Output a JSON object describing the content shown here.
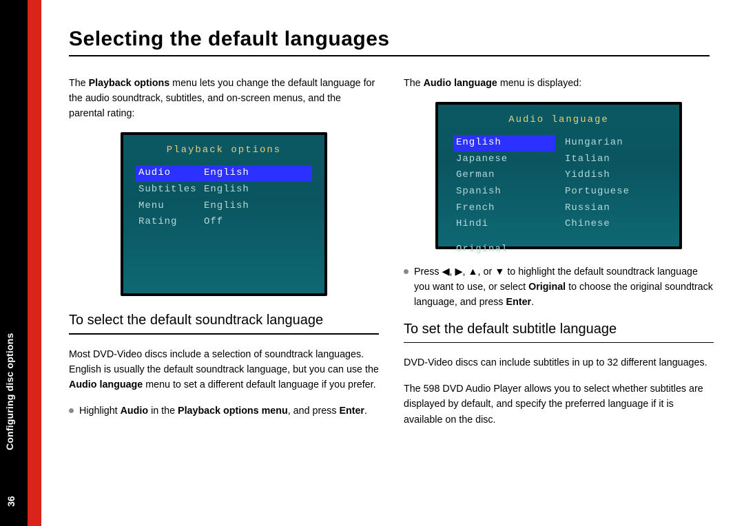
{
  "spine": {
    "section": "Configuring disc options",
    "page_number": "36"
  },
  "title": "Selecting the default languages",
  "left": {
    "intro_pre": "The ",
    "intro_bold": "Playback options",
    "intro_post": " menu lets you change the default language for the audio soundtrack, subtitles, and on-screen menus, and the parental rating:",
    "osd_title": "Playback options",
    "osd_rows": [
      {
        "k": "Audio",
        "v": "English",
        "selected": true
      },
      {
        "k": "Subtitles",
        "v": "English",
        "selected": false
      },
      {
        "k": "Menu",
        "v": "English",
        "selected": false
      },
      {
        "k": "Rating",
        "v": "Off",
        "selected": false
      }
    ],
    "sub_heading": "To select the default soundtrack language",
    "p2_a": "Most DVD-Video discs include a selection of soundtrack languages. English is usually the default soundtrack language, but you can use the ",
    "p2_bold": "Audio language",
    "p2_b": " menu to set a different default language if you prefer.",
    "bullet_a": "Highlight ",
    "bullet_b1": "Audio",
    "bullet_mid": " in the ",
    "bullet_b2": "Playback options menu",
    "bullet_c": ", and press ",
    "bullet_b3": "Enter",
    "bullet_end": "."
  },
  "right": {
    "intro_pre": "The ",
    "intro_bold": "Audio language",
    "intro_post": " menu is displayed:",
    "osd_title": "Audio language",
    "langs_left": [
      "English",
      "Japanese",
      "German",
      "Spanish",
      "French",
      "Hindi"
    ],
    "langs_right": [
      "Hungarian",
      "Italian",
      "Yiddish",
      "Portuguese",
      "Russian",
      "Chinese"
    ],
    "selected_index": 0,
    "original_label": "Original",
    "bullet_a": "Press ",
    "arrows": "◀, ▶, ▲, or ▼",
    "bullet_b": " to highlight the default soundtrack language you want to use, or select ",
    "bullet_bold1": "Original",
    "bullet_c": " to choose the original soundtrack language, and press ",
    "bullet_bold2": "Enter",
    "bullet_end": ".",
    "sub_heading": "To set the default subtitle language",
    "p2": "DVD-Video discs can include subtitles in up to 32 different languages.",
    "p3": "The 598 DVD Audio Player allows you to select whether subtitles are displayed by default, and specify the preferred language if it is available on the disc."
  }
}
